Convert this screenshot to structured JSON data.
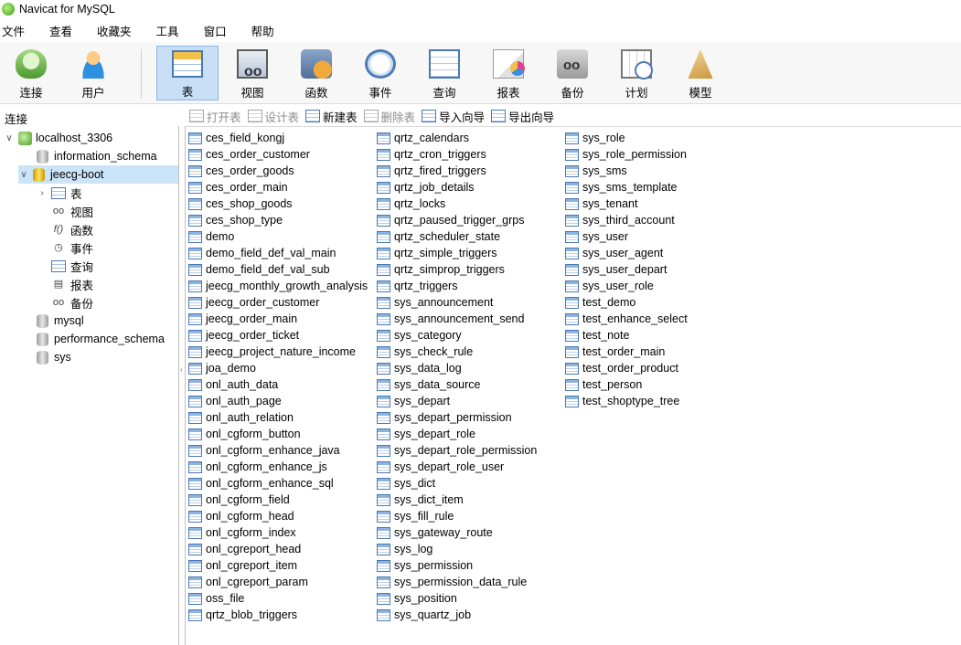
{
  "window": {
    "title": "Navicat for MySQL"
  },
  "menu": [
    "文件",
    "查看",
    "收藏夹",
    "工具",
    "窗口",
    "帮助"
  ],
  "toolbar": [
    {
      "label": "连接",
      "icon": "connection-icon"
    },
    {
      "label": "用户",
      "icon": "user-icon"
    },
    {
      "label": "表",
      "icon": "table-icon",
      "active": true
    },
    {
      "label": "视图",
      "icon": "view-icon"
    },
    {
      "label": "函数",
      "icon": "function-icon"
    },
    {
      "label": "事件",
      "icon": "event-icon"
    },
    {
      "label": "查询",
      "icon": "query-icon"
    },
    {
      "label": "报表",
      "icon": "report-icon"
    },
    {
      "label": "备份",
      "icon": "backup-icon"
    },
    {
      "label": "计划",
      "icon": "schedule-icon"
    },
    {
      "label": "模型",
      "icon": "model-icon"
    }
  ],
  "sidebar": {
    "header": "连接",
    "connection": "localhost_3306",
    "databases": [
      "information_schema",
      "jeecg-boot",
      "mysql",
      "performance_schema",
      "sys"
    ],
    "selected_db": "jeecg-boot",
    "objects": [
      "表",
      "视图",
      "函数",
      "事件",
      "查询",
      "报表",
      "备份"
    ]
  },
  "subtoolbar": [
    {
      "label": "打开表",
      "enabled": false
    },
    {
      "label": "设计表",
      "enabled": false
    },
    {
      "label": "新建表",
      "enabled": true
    },
    {
      "label": "删除表",
      "enabled": false
    },
    {
      "label": "导入向导",
      "enabled": true
    },
    {
      "label": "导出向导",
      "enabled": true
    }
  ],
  "tables": {
    "col1": [
      "ces_field_kongj",
      "ces_order_customer",
      "ces_order_goods",
      "ces_order_main",
      "ces_shop_goods",
      "ces_shop_type",
      "demo",
      "demo_field_def_val_main",
      "demo_field_def_val_sub",
      "jeecg_monthly_growth_analysis",
      "jeecg_order_customer",
      "jeecg_order_main",
      "jeecg_order_ticket",
      "jeecg_project_nature_income",
      "joa_demo",
      "onl_auth_data",
      "onl_auth_page",
      "onl_auth_relation",
      "onl_cgform_button",
      "onl_cgform_enhance_java",
      "onl_cgform_enhance_js",
      "onl_cgform_enhance_sql",
      "onl_cgform_field",
      "onl_cgform_head",
      "onl_cgform_index",
      "onl_cgreport_head",
      "onl_cgreport_item",
      "onl_cgreport_param",
      "oss_file",
      "qrtz_blob_triggers"
    ],
    "col2": [
      "qrtz_calendars",
      "qrtz_cron_triggers",
      "qrtz_fired_triggers",
      "qrtz_job_details",
      "qrtz_locks",
      "qrtz_paused_trigger_grps",
      "qrtz_scheduler_state",
      "qrtz_simple_triggers",
      "qrtz_simprop_triggers",
      "qrtz_triggers",
      "sys_announcement",
      "sys_announcement_send",
      "sys_category",
      "sys_check_rule",
      "sys_data_log",
      "sys_data_source",
      "sys_depart",
      "sys_depart_permission",
      "sys_depart_role",
      "sys_depart_role_permission",
      "sys_depart_role_user",
      "sys_dict",
      "sys_dict_item",
      "sys_fill_rule",
      "sys_gateway_route",
      "sys_log",
      "sys_permission",
      "sys_permission_data_rule",
      "sys_position",
      "sys_quartz_job"
    ],
    "col3": [
      "sys_role",
      "sys_role_permission",
      "sys_sms",
      "sys_sms_template",
      "sys_tenant",
      "sys_third_account",
      "sys_user",
      "sys_user_agent",
      "sys_user_depart",
      "sys_user_role",
      "test_demo",
      "test_enhance_select",
      "test_note",
      "test_order_main",
      "test_order_product",
      "test_person",
      "test_shoptype_tree"
    ]
  }
}
